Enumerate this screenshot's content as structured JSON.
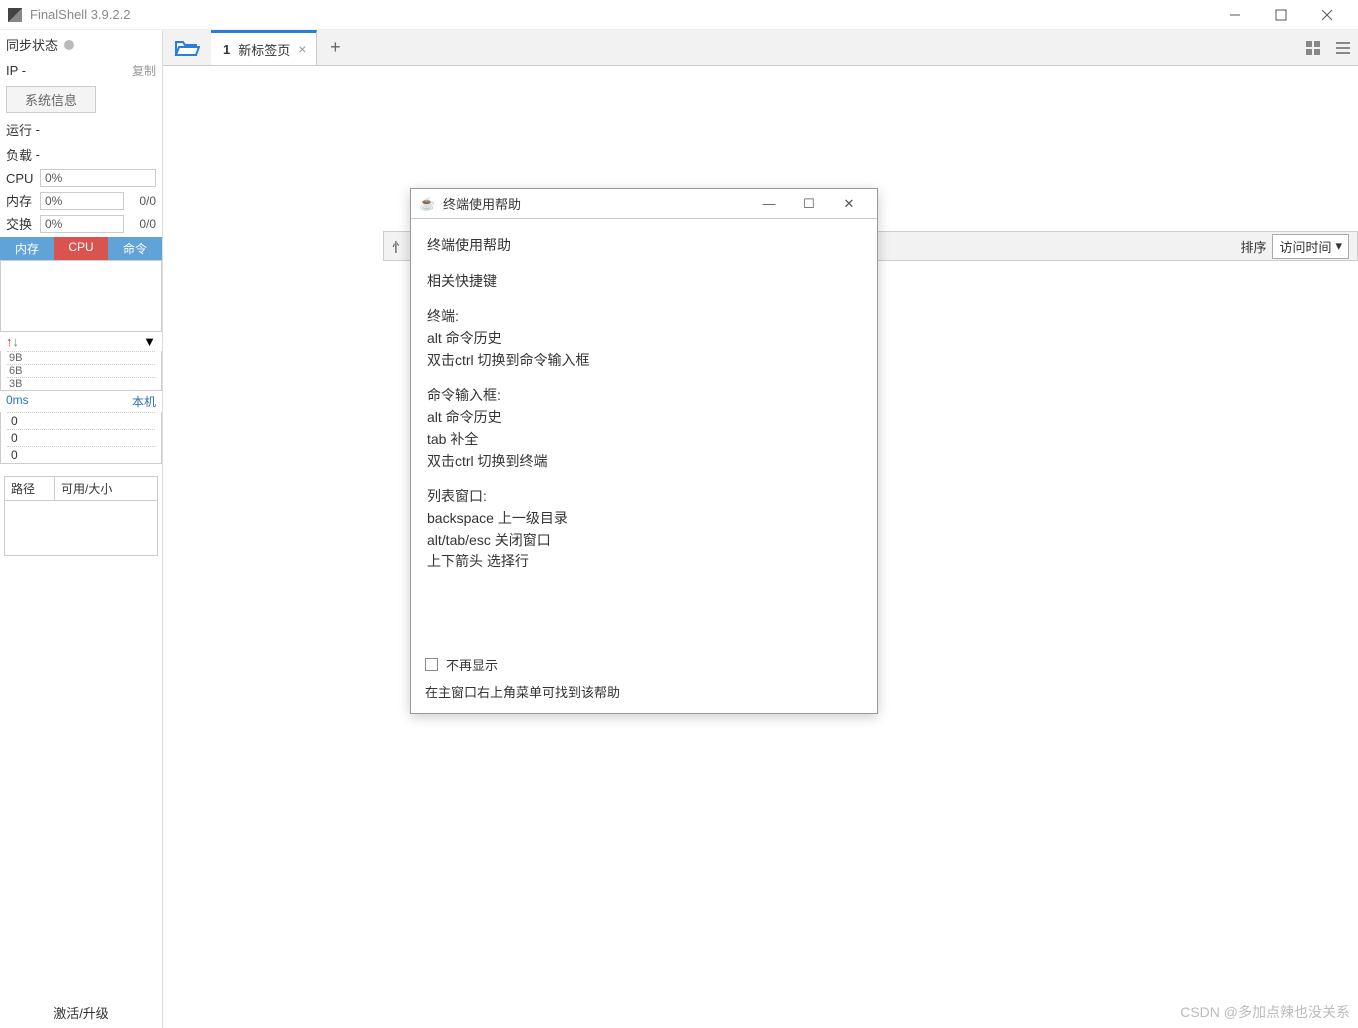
{
  "app": {
    "title": "FinalShell 3.9.2.2"
  },
  "sidebar": {
    "sync_label": "同步状态",
    "ip_label": "IP",
    "ip_value": "-",
    "copy_label": "复制",
    "sysinfo_label": "系统信息",
    "run_label": "运行",
    "run_value": "-",
    "load_label": "负载",
    "load_value": "-",
    "cpu_label": "CPU",
    "cpu_value": "0%",
    "mem_label": "内存",
    "mem_value": "0%",
    "mem_ratio": "0/0",
    "swap_label": "交换",
    "swap_value": "0%",
    "swap_ratio": "0/0",
    "tabs": {
      "mem": "内存",
      "cpu": "CPU",
      "cmd": "命令"
    },
    "net": {
      "up": "↑",
      "down": "↓",
      "drop": "▼"
    },
    "ticks": [
      "9B",
      "6B",
      "3B"
    ],
    "ping_ms": "0ms",
    "ping_host": "本机",
    "ping_vals": [
      "0",
      "0",
      "0"
    ],
    "path_label": "路径",
    "size_label": "可用/大小",
    "activate": "激活/升级"
  },
  "tabs": {
    "tab1_num": "1",
    "tab1_label": "新标签页"
  },
  "toolbar": {
    "sort_label": "排序",
    "sort_value": "访问时间"
  },
  "dialog": {
    "title": "终端使用帮助",
    "h1": "终端使用帮助",
    "h2": "相关快捷键",
    "sec1_title": "终端:",
    "sec1_l1": "alt 命令历史",
    "sec1_l2": "双击ctrl 切换到命令输入框",
    "sec2_title": "命令输入框:",
    "sec2_l1": "alt 命令历史",
    "sec2_l2": "tab 补全",
    "sec2_l3": "双击ctrl 切换到终端",
    "sec3_title": "列表窗口:",
    "sec3_l1": "backspace 上一级目录",
    "sec3_l2": "alt/tab/esc 关闭窗口",
    "sec3_l3": "上下箭头 选择行",
    "checkbox": "不再显示",
    "footer": "在主窗口右上角菜单可找到该帮助"
  },
  "watermark": "CSDN @多加点辣也没关系"
}
